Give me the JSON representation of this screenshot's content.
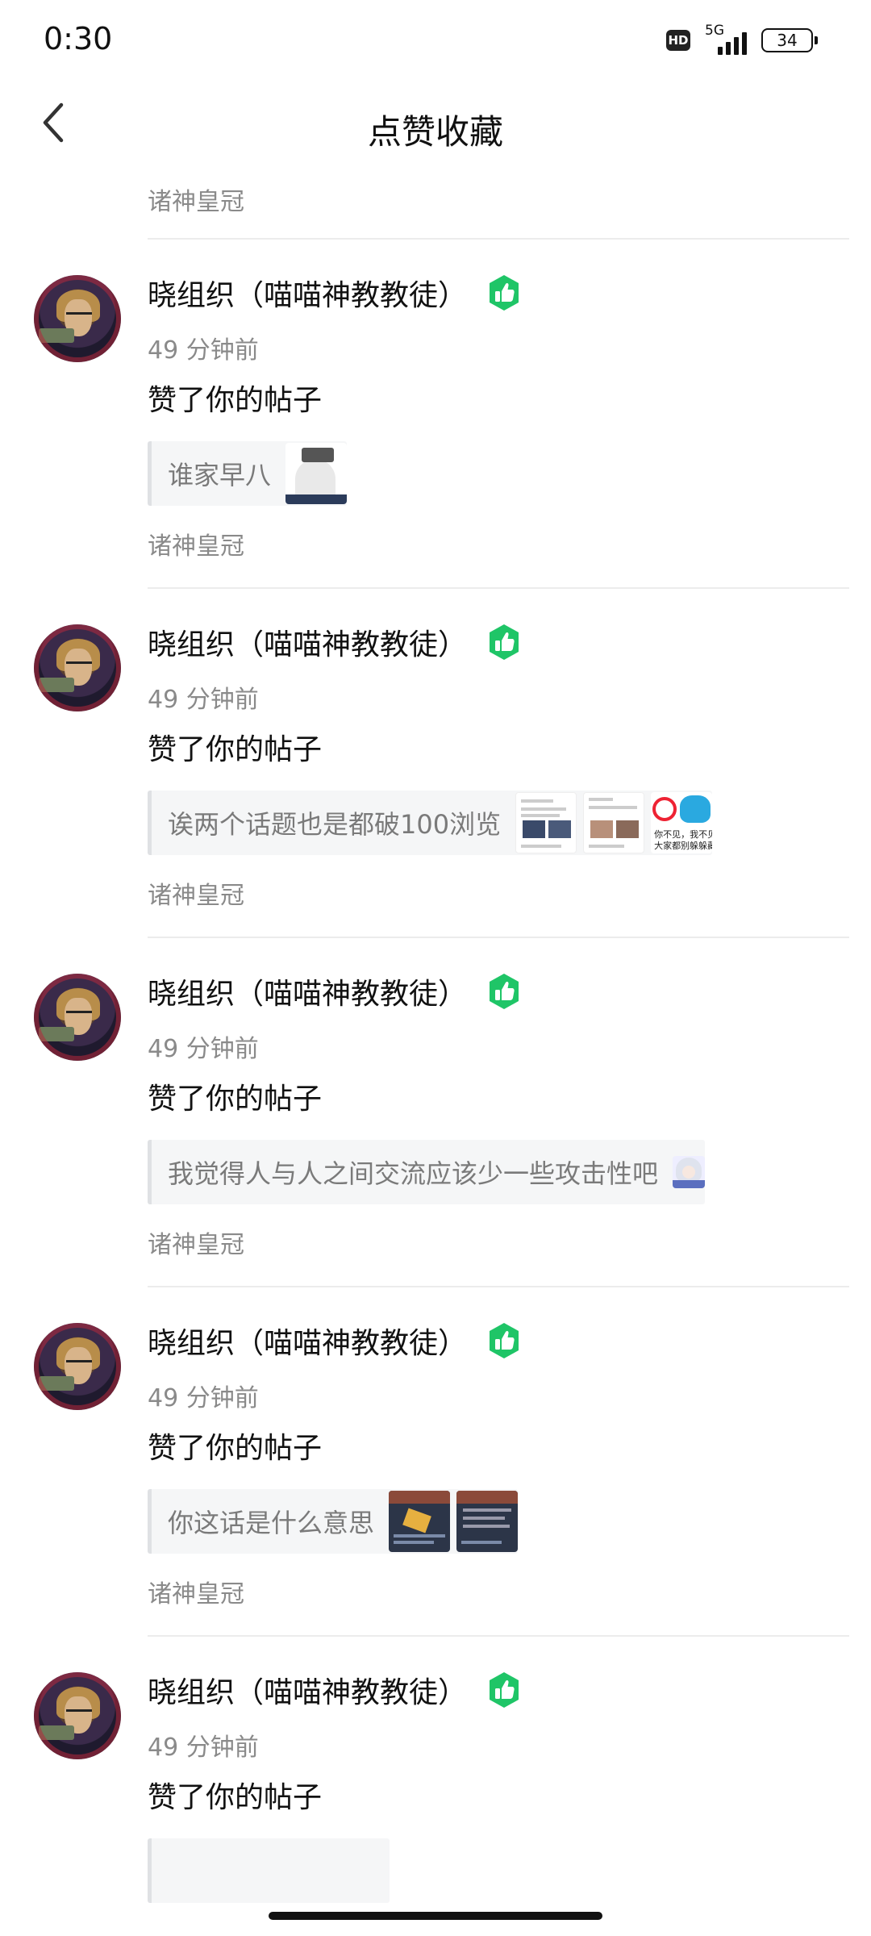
{
  "status_bar": {
    "time": "0:30",
    "hd": "HD",
    "network": "5G",
    "battery": "34"
  },
  "header": {
    "title": "点赞收藏"
  },
  "top_tail": "诸神皇冠",
  "items": [
    {
      "user": "晓组织（喵喵神教教徒）",
      "time": "49 分钟前",
      "action": "赞了你的帖子",
      "quote": "谁家早八",
      "thumbs": [
        "sticker"
      ],
      "tail": "诸神皇冠"
    },
    {
      "user": "晓组织（喵喵神教教徒）",
      "time": "49 分钟前",
      "action": "赞了你的帖子",
      "quote": "诶两个话题也是都破100浏览",
      "thumbs": [
        "screenshot",
        "screenshot",
        "meme"
      ],
      "thumb_meme_text": [
        "你不见，我不见",
        "大家都别躲躲藏藏"
      ],
      "tail": "诸神皇冠"
    },
    {
      "user": "晓组织（喵喵神教教徒）",
      "time": "49 分钟前",
      "action": "赞了你的帖子",
      "quote": "我觉得人与人之间交流应该少一些攻击性吧",
      "thumbs": [
        "anime"
      ],
      "tail": "诸神皇冠"
    },
    {
      "user": "晓组织（喵喵神教教徒）",
      "time": "49 分钟前",
      "action": "赞了你的帖子",
      "quote": "你这话是什么意思",
      "thumbs": [
        "game",
        "game-list"
      ],
      "tail": "诸神皇冠"
    },
    {
      "user": "晓组织（喵喵神教教徒）",
      "time": "49 分钟前",
      "action": "赞了你的帖子",
      "quote": "",
      "thumbs": [],
      "tail": ""
    }
  ],
  "colors": {
    "like_badge": "#1fc567",
    "muted_text": "#8a8a8a",
    "quote_bg": "#f5f6f7"
  },
  "icons": {
    "back": "chevron-left-icon",
    "like": "thumbs-up-icon"
  }
}
